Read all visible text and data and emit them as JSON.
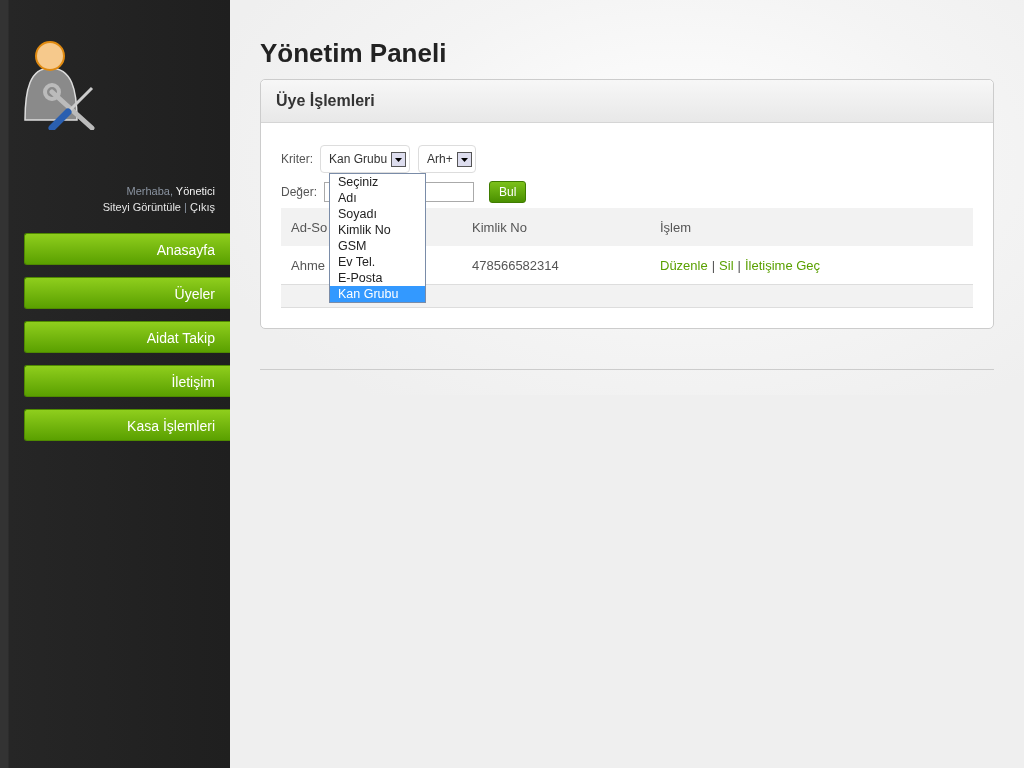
{
  "sidebar": {
    "greeting": "Merhaba,",
    "user": "Yönetici",
    "links": [
      "Siteyi Görüntüle",
      "Çıkış"
    ],
    "link_separator": "|",
    "nav": [
      {
        "label": "Anasayfa"
      },
      {
        "label": "Üyeler"
      },
      {
        "label": "Aidat Takip"
      },
      {
        "label": "İletişim"
      },
      {
        "label": "Kasa İşlemleri"
      }
    ]
  },
  "page_title": "Yönetim Paneli",
  "panel": {
    "title": "Üye İşlemleri",
    "filter": {
      "criterion_label": "Kriter:",
      "criterion_value": "Kan Grubu",
      "blood_group_value": "Arh+",
      "value_label": "Değer:",
      "search_button": "Bul",
      "criterion_options": [
        {
          "label": "Seçiniz",
          "selected": false
        },
        {
          "label": "Adı",
          "selected": false
        },
        {
          "label": "Soyadı",
          "selected": false
        },
        {
          "label": "Kimlik No",
          "selected": false
        },
        {
          "label": "GSM",
          "selected": false
        },
        {
          "label": "Ev Tel.",
          "selected": false
        },
        {
          "label": "E-Posta",
          "selected": false
        },
        {
          "label": "Kan Grubu",
          "selected": true
        }
      ]
    },
    "table": {
      "columns": [
        "Ad-So",
        "Kimlik No",
        "İşlem"
      ],
      "rows": [
        {
          "cells": [
            "Ahme",
            "478566582314"
          ],
          "actions": [
            "Düzenle",
            "Sil",
            "İletişime Geç"
          ],
          "separator": "|"
        }
      ]
    }
  }
}
